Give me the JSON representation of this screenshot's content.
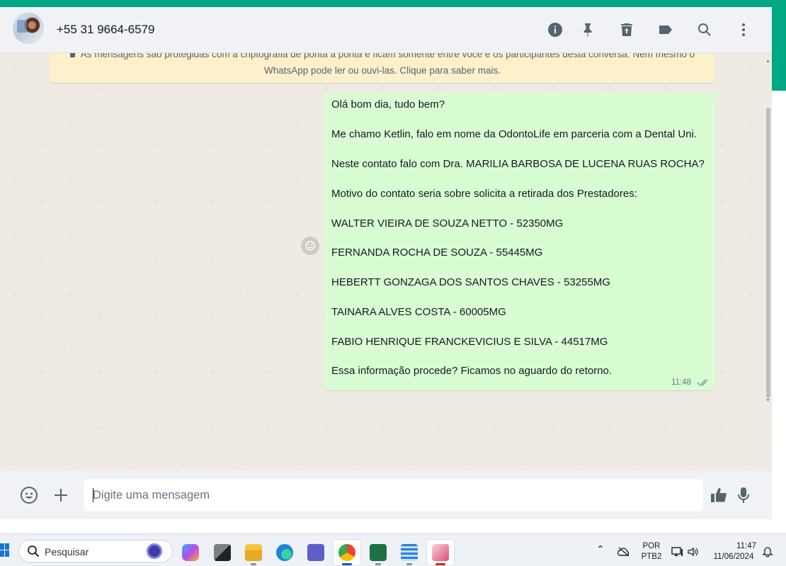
{
  "header": {
    "contact_name": "+55 31 9664-6579"
  },
  "chat": {
    "encryption_notice_line1": "As mensagens são protegidas com a criptografia de ponta a ponta e ficam somente entre você e os participantes desta conversa. Nem mesmo o",
    "encryption_notice_line2": "WhatsApp pode ler ou ouvi-las. Clique para saber mais.",
    "message": {
      "lines": [
        "Olá bom dia, tudo bem?",
        "Me chamo Ketlin, falo em nome da OdontoLife em parceria com a Dental Uni.",
        "Neste contato falo com Dra. MARILIA BARBOSA DE LUCENA RUAS ROCHA?",
        "Motivo do contato seria sobre solicita a retirada dos Prestadores:",
        "WALTER VIEIRA DE SOUZA NETTO - 52350MG",
        "FERNANDA ROCHA DE SOUZA - 55445MG",
        "HEBERTT GONZAGA DOS SANTOS CHAVES - 53255MG",
        "TAINARA ALVES COSTA - 60005MG",
        "FABIO HENRIQUE FRANCKEVICIUS E SILVA - 44517MG",
        "Essa informação procede? Ficamos no aguardo do retorno."
      ],
      "time": "11:48",
      "status": "delivered"
    }
  },
  "footer": {
    "input_placeholder": "Digite uma mensagem",
    "input_value": ""
  },
  "taskbar": {
    "search_label": "Pesquisar",
    "language_line1": "POR",
    "language_line2": "PTB2",
    "clock_time": "11:47",
    "clock_date": "11/06/2024"
  },
  "colors": {
    "accent": "#00a884",
    "bubble_out": "#d9fdd3",
    "chat_bg": "#efeae2",
    "encryption_bg": "#fdf1cc",
    "icon": "#54656f"
  }
}
